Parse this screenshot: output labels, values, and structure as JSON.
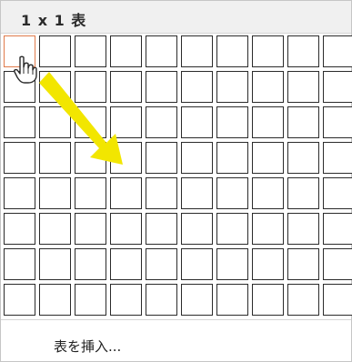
{
  "header": {
    "title": "1 x 1 表"
  },
  "grid": {
    "columns": 10,
    "rows": 8,
    "selected_rows": 1,
    "selected_columns": 1
  },
  "menu": {
    "insert_table_label": "表を挿入..."
  },
  "overlay": {
    "arrow_color": "#f2e600",
    "cursor_icon": "hand-pointer-icon"
  },
  "colors": {
    "header_bg": "#f0f0f0",
    "cell_border": "#2b2b2b",
    "active_cell_border": "#e07a4a"
  }
}
